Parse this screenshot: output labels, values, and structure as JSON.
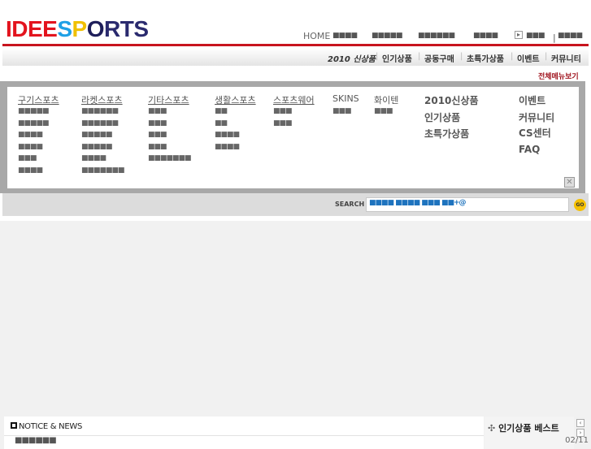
{
  "logo": {
    "text": "IDEESPORTS"
  },
  "util": {
    "home": "HOME",
    "items": [
      "■■■■",
      "■■■■■",
      "■■■■■■",
      "■■■■"
    ],
    "extra1": "■■■",
    "extra2": "■■■■"
  },
  "gnb": [
    "2010 신상품",
    "인기상품",
    "공동구매",
    "초특가상품",
    "이벤트",
    "커뮤니티"
  ],
  "all_menu": "전체메뉴보기",
  "menu": {
    "columns": [
      {
        "title": "구기스포츠",
        "items": [
          "■■■■■",
          "■■■■■",
          "■■■■",
          "■■■■",
          "■■■",
          "■■■■"
        ]
      },
      {
        "title": "라켓스포츠",
        "items": [
          "■■■■■■",
          "■■■■■■",
          "■■■■■",
          "■■■■■",
          "■■■■",
          "■■■■■■■"
        ]
      },
      {
        "title": "기타스포츠",
        "items": [
          "■■■",
          "■■■",
          "■■■",
          "■■■",
          "■■■■■■■"
        ]
      },
      {
        "title": "생활스포츠",
        "items": [
          "■■",
          "■■",
          "■■■■",
          "■■■■"
        ]
      },
      {
        "title": "스포츠웨어",
        "items": [
          "■■■",
          "■■■"
        ]
      },
      {
        "title": "SKINS",
        "items": [
          "■■■"
        ]
      },
      {
        "title": "화이텐",
        "items": [
          "■■■"
        ]
      }
    ],
    "featured": [
      "2010신상품",
      "인기상품",
      "초특가상품"
    ],
    "links": [
      "이벤트",
      "커뮤니티",
      "CS센터",
      "FAQ"
    ]
  },
  "search": {
    "label": "SEARCH",
    "value": "■■■■ ■■■■ ■■■ ■■+@",
    "go": "GO"
  },
  "notice": {
    "title": "NOTICE & NEWS",
    "item": "■■■■■■"
  },
  "best": {
    "title": "인기상품 베스트",
    "date": "02/11"
  }
}
